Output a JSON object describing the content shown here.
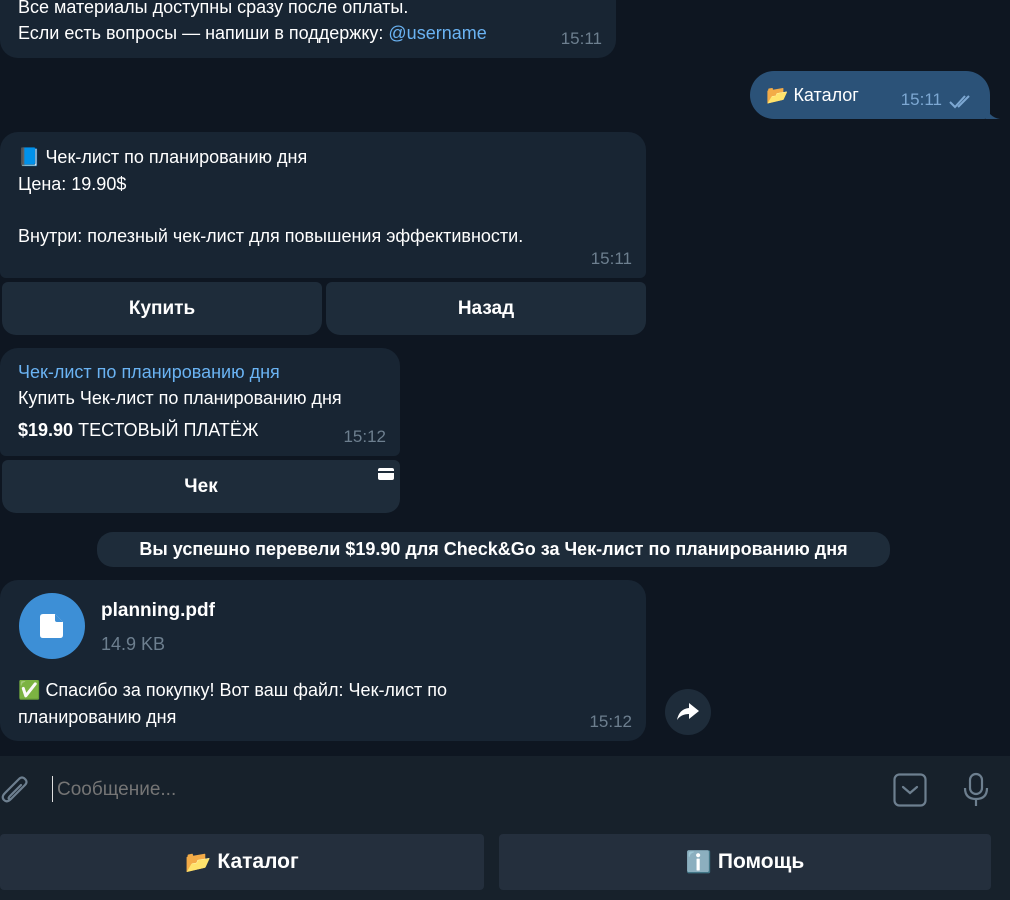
{
  "messages": {
    "m1": {
      "line1": "Все материалы доступны сразу после оплаты.",
      "line2_prefix": "Если есть вопросы — напиши в поддержку: ",
      "line2_link": "@username",
      "time": "15:11"
    },
    "m2": {
      "emoji": "📂",
      "text": "Каталог",
      "time": "15:11"
    },
    "m3": {
      "emoji": "📘",
      "title": "Чек-лист по планированию дня",
      "price_line": "Цена: 19.90$",
      "desc": "Внутри: полезный чек-лист для повышения эффективности.",
      "time": "15:11",
      "buttons": [
        "Купить",
        "Назад"
      ]
    },
    "m4": {
      "title": "Чек-лист по планированию дня",
      "desc": "Купить Чек-лист по планированию дня",
      "amount": "$19.90",
      "test_label": "ТЕСТОВЫЙ ПЛАТЁЖ",
      "time": "15:12",
      "button": "Чек"
    },
    "service": "Вы успешно перевели $19.90 для Check&Go за Чек-лист по планированию дня",
    "m5": {
      "file_name": "planning.pdf",
      "file_size": "14.9 KB",
      "emoji": "✅",
      "caption_line1": "Спасибо за покупку! Вот ваш файл: Чек-лист по",
      "caption_line2": "планированию дня",
      "time": "15:12"
    }
  },
  "composer": {
    "placeholder": "Сообщение..."
  },
  "reply_keyboard": [
    {
      "emoji": "📂",
      "label": "Каталог"
    },
    {
      "emoji": "ℹ️",
      "label": "Помощь"
    }
  ],
  "colors": {
    "background": "#0e1621",
    "incoming_bubble": "#182533",
    "outgoing_bubble": "#2b5278",
    "link": "#6ab3f3",
    "accent": "#3d8fd6"
  }
}
